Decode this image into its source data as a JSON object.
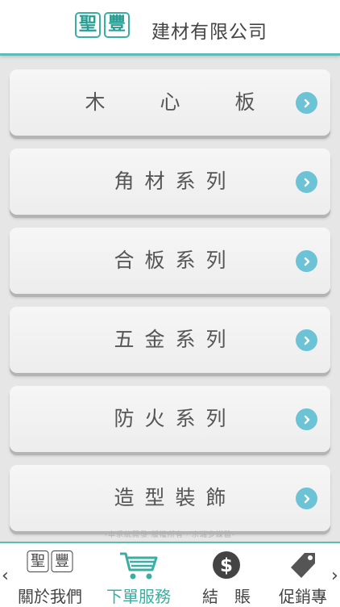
{
  "header": {
    "logo_chars": [
      "聖",
      "豐"
    ],
    "company_name": "建材有限公司"
  },
  "menu": [
    {
      "label": "木 心 板"
    },
    {
      "label": "角材系列"
    },
    {
      "label": "合板系列"
    },
    {
      "label": "五金系列"
    },
    {
      "label": "防火系列"
    },
    {
      "label": "造型裝飾"
    }
  ],
  "footer_note": "-本系統開發 版權所有・宗瑞多媒體-",
  "tabbar": {
    "tabs": [
      {
        "label": "關於我們",
        "icon": "logo-icon"
      },
      {
        "label": "下單服務",
        "icon": "cart-icon"
      },
      {
        "label": "結　賬",
        "icon": "dollar-icon"
      },
      {
        "label": "促銷專",
        "icon": "tag-icon"
      }
    ],
    "left_arrow": "‹",
    "right_arrow": "›"
  },
  "colors": {
    "accent": "#5bbdb6",
    "arrow": "#6cc3d6",
    "active_tab": "#3aaea3"
  }
}
